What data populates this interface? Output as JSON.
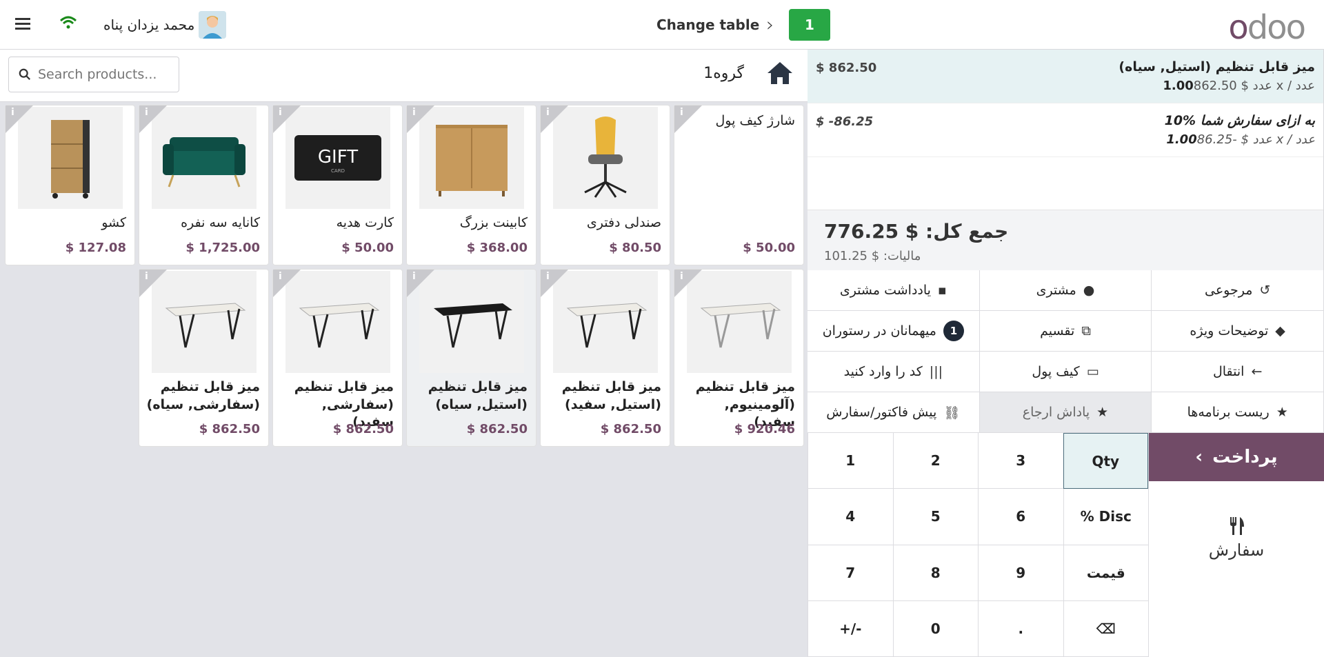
{
  "topbar": {
    "table_number": "1",
    "change_table": "Change table",
    "user_name": "محمد یزدان پناه"
  },
  "order": {
    "lines": [
      {
        "name": "میز قابل تنظیم (استیل, سیاه)",
        "price": "$ 862.50",
        "qty": "1.00",
        "unit": "عدد",
        "detail": "$ 862.50 x / عدد",
        "selected": true
      },
      {
        "name": "10% به ازای سفارش شما",
        "price": "$ -86.25",
        "qty": "1.00",
        "unit": "عدد",
        "detail": "$ -86.25 x / عدد",
        "selected": false
      }
    ],
    "total": "جمع کل: $ 776.25",
    "tax": "مالیات: $ 101.25"
  },
  "controls": [
    {
      "label": "یادداشت مشتری",
      "icon": "note-icon"
    },
    {
      "label": "مشتری",
      "icon": "user-icon"
    },
    {
      "label": "مرجوعی",
      "icon": "undo-icon"
    },
    {
      "label": "میهمانان در رستوران",
      "icon": "guests-badge",
      "badge": "1"
    },
    {
      "label": "تقسیم",
      "icon": "split-icon"
    },
    {
      "label": "توضیحات ویژه",
      "icon": "tag-icon"
    },
    {
      "label": "کد را وارد کنید",
      "icon": "barcode-icon"
    },
    {
      "label": "کیف پول",
      "icon": "card-icon"
    },
    {
      "label": "انتقال",
      "icon": "arrow-left-icon"
    },
    {
      "label": "پیش فاکتور/سفارش",
      "icon": "link-icon"
    },
    {
      "label": "پاداش ارجاع",
      "icon": "star-icon"
    },
    {
      "label": "ریست برنامه‌ها",
      "icon": "star-icon"
    }
  ],
  "payment": {
    "pay_label": "پرداخت",
    "order_label": "سفارش"
  },
  "numpad": [
    "1",
    "2",
    "3",
    "Qty",
    "4",
    "5",
    "6",
    "% Disc",
    "7",
    "8",
    "9",
    "قیمت",
    "+/-",
    "0",
    ".",
    "⌫"
  ],
  "products_header": {
    "group": "گروه1",
    "search_placeholder": "Search products..."
  },
  "products": [
    {
      "name": "شارژ کیف پول",
      "price": "$ 50.00",
      "img": "none"
    },
    {
      "name": "صندلی دفتری",
      "price": "$ 80.50",
      "img": "chair"
    },
    {
      "name": "کابینت بزرگ",
      "price": "$ 368.00",
      "img": "cabinet"
    },
    {
      "name": "کارت هدیه",
      "price": "$ 50.00",
      "img": "gift"
    },
    {
      "name": "کانایه سه نفره",
      "price": "$ 1,725.00",
      "img": "sofa"
    },
    {
      "name": "کشو",
      "price": "$ 127.08",
      "img": "drawer"
    },
    {
      "name": "میز قابل تنظیم (آلومینیوم, سفید)",
      "price": "$ 920.46",
      "img": "desk-grey"
    },
    {
      "name": "میز قابل تنظیم (استیل, سفید)",
      "price": "$ 862.50",
      "img": "desk-white"
    },
    {
      "name": "میز قابل تنظیم (استیل, سیاه)",
      "price": "$ 862.50",
      "img": "desk-black"
    },
    {
      "name": "میز قابل تنظیم (سفارشی, سفید)",
      "price": "$ 862.50",
      "img": "desk-white"
    },
    {
      "name": "میز قابل تنظیم (سفارشی, سیاه)",
      "price": "$ 862.50",
      "img": "desk-white"
    }
  ],
  "colors": {
    "brand": "#714b67",
    "table_badge": "#28a745"
  }
}
